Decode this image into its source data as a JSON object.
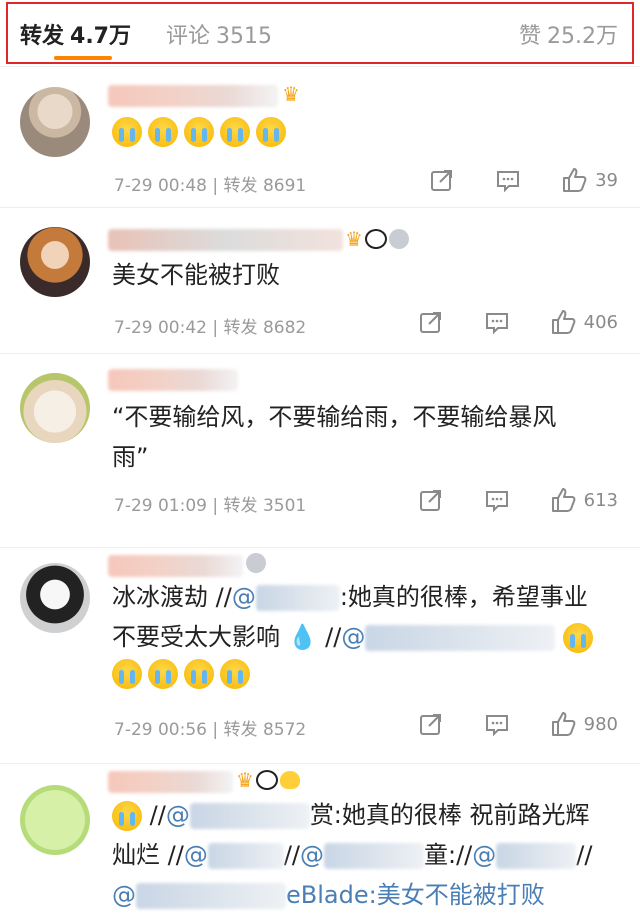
{
  "tabs": {
    "repost_label": "转发",
    "repost_count": "4.7万",
    "comment_label": "评论",
    "comment_count": "3515",
    "like_label": "赞",
    "like_count": "25.2万"
  },
  "items": [
    {
      "content": "",
      "time": "7-29 00:48",
      "separator": "|",
      "repost_label": "转发",
      "repost_count": "8691",
      "likes": "39",
      "badges": [
        "crown-icon"
      ]
    },
    {
      "content": "美女不能被打败",
      "time": "7-29 00:42",
      "separator": "|",
      "repost_label": "转发",
      "repost_count": "8682",
      "likes": "406",
      "badges": [
        "crown-icon",
        "panda-icon",
        "medal-icon"
      ]
    },
    {
      "content": "“不要输给风，不要输给雨，不要输给暴风雨”",
      "time": "7-29 01:09",
      "separator": "|",
      "repost_label": "转发",
      "repost_count": "3501",
      "likes": "613",
      "badges": []
    },
    {
      "content_a": "冰冰渡劫 //",
      "content_b": ":她真的很棒，希望事业",
      "content_c": "不要受太大影响",
      "content_d": "//",
      "mention_prefix": "@",
      "time": "7-29 00:56",
      "separator": "|",
      "repost_label": "转发",
      "repost_count": "8572",
      "likes": "980",
      "badges": [
        "medal-icon"
      ]
    },
    {
      "content_a": "//",
      "content_b": "赏:她真的很棒 祝前路光辉",
      "content_c": "灿烂 //",
      "content_d": "//",
      "content_e": "童://",
      "content_f": "//",
      "content_g": "eBlade:美女不能被打败",
      "mention_prefix": "@",
      "badges": [
        "crown-icon",
        "panda-icon",
        "duck-icon"
      ]
    }
  ],
  "colors": {
    "accent": "#ff8200",
    "highlight_border": "#e0262a",
    "mention": "#4a7fb5"
  }
}
